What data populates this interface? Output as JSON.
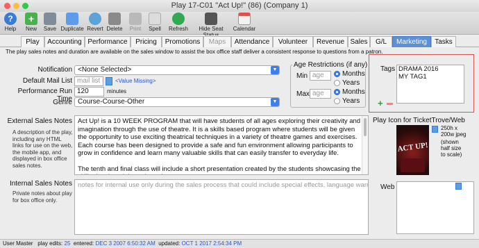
{
  "window": {
    "title": "Play 17-C01 \"Act Up!\" (86) (Company 1)"
  },
  "toolbar": [
    {
      "label": "Help",
      "icon": "help-icon",
      "color": "#3a7bd5"
    },
    {
      "label": "New",
      "icon": "new-icon",
      "color": "#4caf50"
    },
    {
      "label": "Save",
      "icon": "save-icon",
      "color": "#7f8c9a"
    },
    {
      "label": "Duplicate",
      "icon": "duplicate-icon",
      "color": "#5d9cec"
    },
    {
      "label": "Revert",
      "icon": "revert-icon",
      "color": "#5da3d9"
    },
    {
      "label": "Delete",
      "icon": "delete-icon",
      "color": "#8a8a8a"
    },
    {
      "label": "Print",
      "icon": "print-icon",
      "color": "#9a9a9a"
    },
    {
      "label": "Spell",
      "icon": "spell-icon",
      "color": "#c9c9c9"
    },
    {
      "label": "Refresh",
      "icon": "refresh-icon",
      "color": "#33a852"
    },
    {
      "label": "Hide Seat Status",
      "icon": "seat-status-icon",
      "color": "#555"
    },
    {
      "label": "Calendar",
      "icon": "calendar-icon",
      "color": "#d8d8d8"
    }
  ],
  "tabs": [
    "Play",
    "Accounting",
    "Performance",
    "Pricing",
    "Promotions",
    "Maps",
    "Attendance",
    "Volunteer",
    "Revenue",
    "Sales",
    "G/L",
    "Marketing",
    "Tasks"
  ],
  "active_tab": "Marketing",
  "info_note": "The play sales notes and duration are available on the sales window to assist the box office staff deliver a consistent response to questions from a patron.",
  "form": {
    "notification_label": "Notification",
    "notification_value": "<None Selected>",
    "mail_list_label": "Default Mail List",
    "mail_list_placeholder": "mail list #",
    "mail_list_missing": "<Value Missing>",
    "run_time_label": "Performance Run Time",
    "run_time_value": "120",
    "run_time_unit": "minutes",
    "genre_label": "Genre",
    "genre_value": "Course-Course-Other"
  },
  "age": {
    "title": "Age Restrictions (if any)",
    "min_label": "Min",
    "max_label": "Max",
    "placeholder": "age",
    "months": "Months",
    "years": "Years"
  },
  "tags": {
    "label": "Tags",
    "items": [
      "DRAMA 2016",
      "MY TAG1"
    ]
  },
  "external": {
    "label": "External Sales Notes",
    "description": "A description of the play, including any HTML links for use on the web, the mobile app, and displayed in box office sales notes.",
    "text_p1": "Act Up! is a 10 WEEK PROGRAM that will have students of all ages exploring their creativity and imagination through the use of theatre. It is a skills based program where students will be given the opportunity to use exciting theatrical techniques in a variety of theatre games and exercises. Each course has been designed to provide a safe and fun environment allowing participants to grow in confidence and learn many valuable skills that can easily transfer to everyday life.",
    "text_p2": "The tenth and final class will include a short presentation created by the students showcasing the skills developed throughout the program."
  },
  "internal": {
    "label": "Internal Sales Notes",
    "description": "Private notes about play for box office only.",
    "placeholder": "notes for internal use only during the sales process that could include special effects, language warnin"
  },
  "play_icon": {
    "label": "Play Icon for TicketTrove/Web",
    "size_note": "250h x 200w jpeg",
    "scale_note": "(shown half size to scale)",
    "poster_text": "ACT UP!"
  },
  "web_label": "Web",
  "status": {
    "user": "User Master",
    "edits_label": "play edits:",
    "edits": "25",
    "entered_label": "entered:",
    "entered": "DEC 3 2007 6:50:32 AM",
    "updated_label": "updated:",
    "updated": "OCT 1 2017 2:54:34 PM"
  }
}
